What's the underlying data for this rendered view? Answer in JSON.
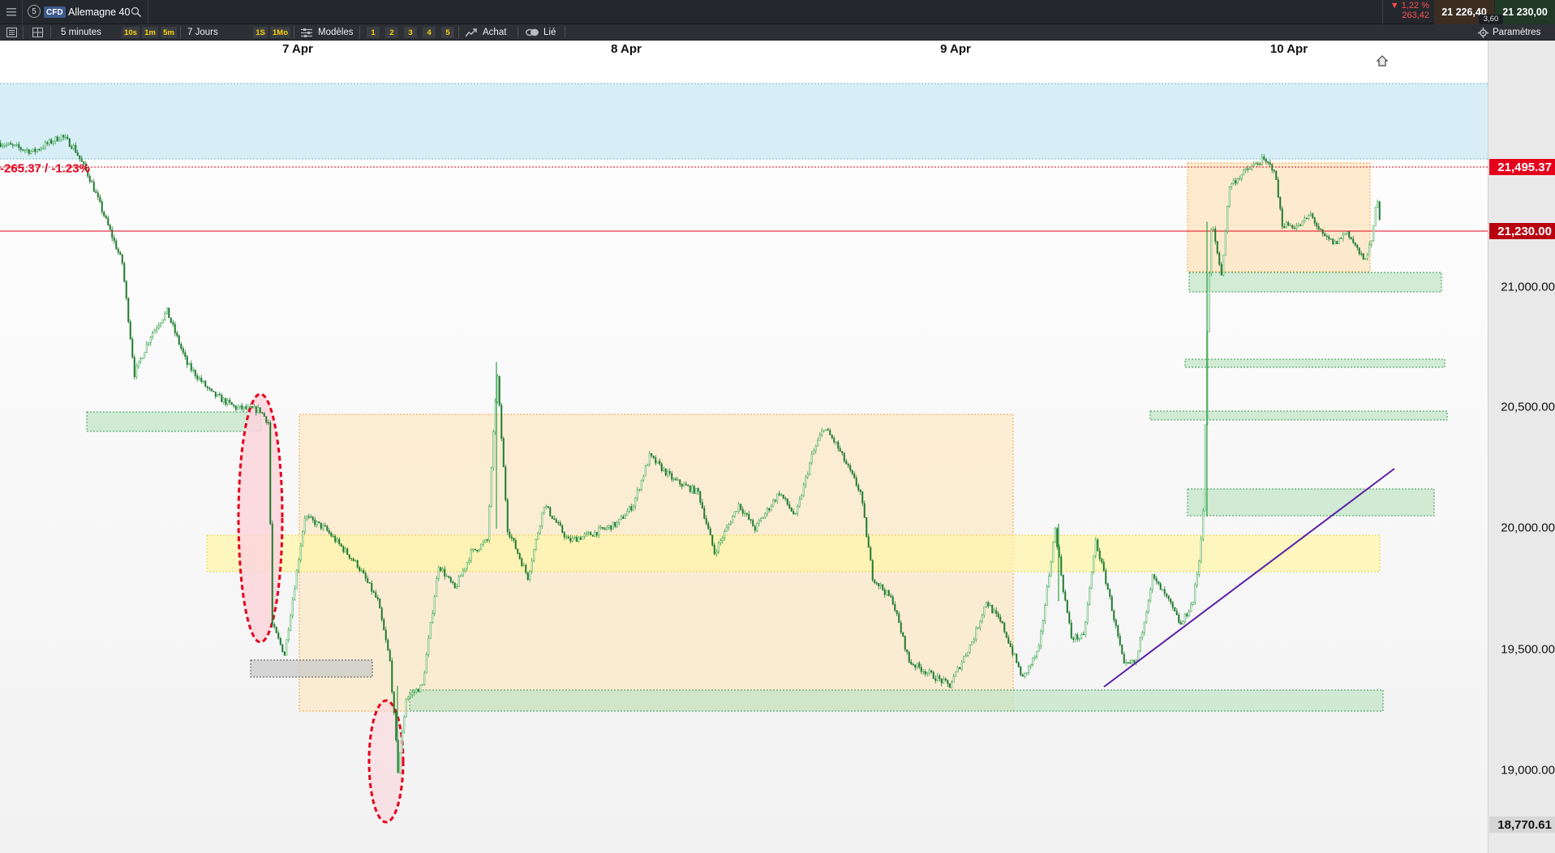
{
  "window": {
    "instrument_number": "5",
    "instrument_type": "CFD",
    "instrument_name": "Allemagne 40"
  },
  "quote": {
    "change_pct": "▼ 1,22 %",
    "change_pts": "263,42",
    "bid": "21 226,40",
    "ask": "21 230,00",
    "spread": "3,60"
  },
  "toolbar": {
    "timeframe": "5 minutes",
    "quick_intervals": [
      "10s",
      "1m",
      "5m"
    ],
    "period": "7 Jours",
    "quick_periods": [
      "1S",
      "1Mo"
    ],
    "templates_label": "Modèles",
    "layouts": [
      "1",
      "2",
      "3",
      "4",
      "5"
    ],
    "buy_label": "Achat",
    "link_label": "Lié",
    "settings_label": "Paramètres"
  },
  "colors": {
    "candle_up": "#2ea043",
    "candle_down": "#1f7a2f",
    "price_line": "#e4001b",
    "trendline": "#5b1fa8",
    "zone_orange": "#fde4bd",
    "zone_green": "#bfe4c4",
    "zone_yellow": "#fff6a6",
    "zone_blue": "#cdeaf5",
    "zone_pink": "#fbd5dc"
  },
  "chart_data": {
    "type": "candlestick",
    "interval": "5 minutes",
    "x_labels": [
      "7 Apr",
      "8 Apr",
      "9 Apr",
      "10 Apr"
    ],
    "y_ticks": [
      "21,000.00",
      "20,500.00",
      "20,000.00",
      "19,500.00",
      "19,000.00"
    ],
    "y_tick_values": [
      21000,
      20500,
      20000,
      19500,
      19000
    ],
    "ylim": [
      18770.61,
      21700
    ],
    "current_price": "21,230.00",
    "current_price_value": 21230,
    "reference_price": "21,495.37",
    "reference_price_value": 21495.37,
    "low_marker": "18,770.61",
    "low_marker_value": 18770.61,
    "change_label": "-265.37 / -1.23%",
    "path": [
      [
        0,
        21595
      ],
      [
        40,
        21560
      ],
      [
        75,
        21625
      ],
      [
        90,
        21580
      ],
      [
        110,
        21450
      ],
      [
        150,
        21100
      ],
      [
        165,
        20640
      ],
      [
        185,
        20800
      ],
      [
        205,
        20900
      ],
      [
        230,
        20680
      ],
      [
        260,
        20560
      ],
      [
        290,
        20500
      ],
      [
        320,
        20490
      ],
      [
        330,
        20440
      ],
      [
        335,
        19600
      ],
      [
        350,
        19480
      ],
      [
        375,
        20050
      ],
      [
        400,
        20000
      ],
      [
        440,
        19850
      ],
      [
        465,
        19700
      ],
      [
        480,
        19450
      ],
      [
        490,
        19000
      ],
      [
        500,
        19300
      ],
      [
        520,
        19350
      ],
      [
        540,
        19850
      ],
      [
        560,
        19750
      ],
      [
        580,
        19900
      ],
      [
        600,
        19950
      ],
      [
        612,
        20650
      ],
      [
        625,
        20000
      ],
      [
        650,
        19800
      ],
      [
        670,
        20100
      ],
      [
        700,
        19950
      ],
      [
        730,
        19980
      ],
      [
        760,
        20020
      ],
      [
        780,
        20100
      ],
      [
        800,
        20300
      ],
      [
        830,
        20200
      ],
      [
        860,
        20150
      ],
      [
        880,
        19900
      ],
      [
        910,
        20100
      ],
      [
        930,
        20000
      ],
      [
        960,
        20150
      ],
      [
        980,
        20050
      ],
      [
        1000,
        20300
      ],
      [
        1015,
        20420
      ],
      [
        1030,
        20350
      ],
      [
        1060,
        20150
      ],
      [
        1075,
        19800
      ],
      [
        1100,
        19700
      ],
      [
        1120,
        19450
      ],
      [
        1145,
        19400
      ],
      [
        1170,
        19350
      ],
      [
        1200,
        19550
      ],
      [
        1215,
        19700
      ],
      [
        1235,
        19600
      ],
      [
        1260,
        19380
      ],
      [
        1280,
        19500
      ],
      [
        1300,
        20000
      ],
      [
        1310,
        19750
      ],
      [
        1320,
        19550
      ],
      [
        1335,
        19550
      ],
      [
        1350,
        19950
      ],
      [
        1365,
        19750
      ],
      [
        1385,
        19430
      ],
      [
        1400,
        19450
      ],
      [
        1420,
        19800
      ],
      [
        1440,
        19700
      ],
      [
        1455,
        19600
      ],
      [
        1470,
        19700
      ],
      [
        1478,
        19880
      ],
      [
        1483,
        20100
      ],
      [
        1488,
        20900
      ],
      [
        1493,
        21270
      ],
      [
        1505,
        21050
      ],
      [
        1515,
        21420
      ],
      [
        1535,
        21480
      ],
      [
        1555,
        21525
      ],
      [
        1570,
        21490
      ],
      [
        1580,
        21260
      ],
      [
        1600,
        21250
      ],
      [
        1615,
        21300
      ],
      [
        1630,
        21210
      ],
      [
        1645,
        21180
      ],
      [
        1660,
        21230
      ],
      [
        1680,
        21110
      ],
      [
        1690,
        21180
      ],
      [
        1697,
        21380
      ],
      [
        1702,
        21230
      ]
    ]
  }
}
